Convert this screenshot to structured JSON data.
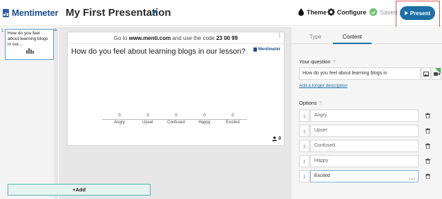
{
  "app": {
    "logo_text": "Mentimeter",
    "presentation_title": "My First Presentation"
  },
  "toolbar": {
    "theme_label": "Theme",
    "configure_label": "Configure",
    "saved_label": "Saved",
    "present_label": "Present"
  },
  "rail": {
    "slide_number": "1",
    "slide_thumb_text": "How do you feel about learning blogs in our..."
  },
  "slide": {
    "join_prefix": "Go to",
    "join_url": "www.menti.com",
    "join_middle": "and use the code",
    "join_code": "23 00 99",
    "question": "How do you feel about learning blogs in our lesson?",
    "brand": "Mentimeter",
    "participants": "0",
    "options": [
      {
        "label": "Angry",
        "value": "0"
      },
      {
        "label": "Upset",
        "value": "0"
      },
      {
        "label": "Confused",
        "value": "0"
      },
      {
        "label": "Happy",
        "value": "0"
      },
      {
        "label": "Excited",
        "value": "0"
      }
    ]
  },
  "panel": {
    "tabs": [
      {
        "label": "Type"
      },
      {
        "label": "Content"
      }
    ],
    "active_tab": "Content",
    "question_label": "Your question",
    "question_value": "How do you feel about learning blogs in",
    "description_link": "Add a longer description",
    "options_label": "Options",
    "options": [
      {
        "value": "Angry"
      },
      {
        "value": "Upset"
      },
      {
        "value": "Confused"
      },
      {
        "value": "Happy"
      },
      {
        "value": "Excited",
        "char_count": "143"
      }
    ],
    "add_label": "+Add"
  },
  "colors": {
    "brand": "#1e4f8f",
    "present_button": "#1d6fa5",
    "saved_check": "#6cc26c",
    "highlight_box": "#d9534f",
    "add_button_border": "#5ab4a8"
  }
}
